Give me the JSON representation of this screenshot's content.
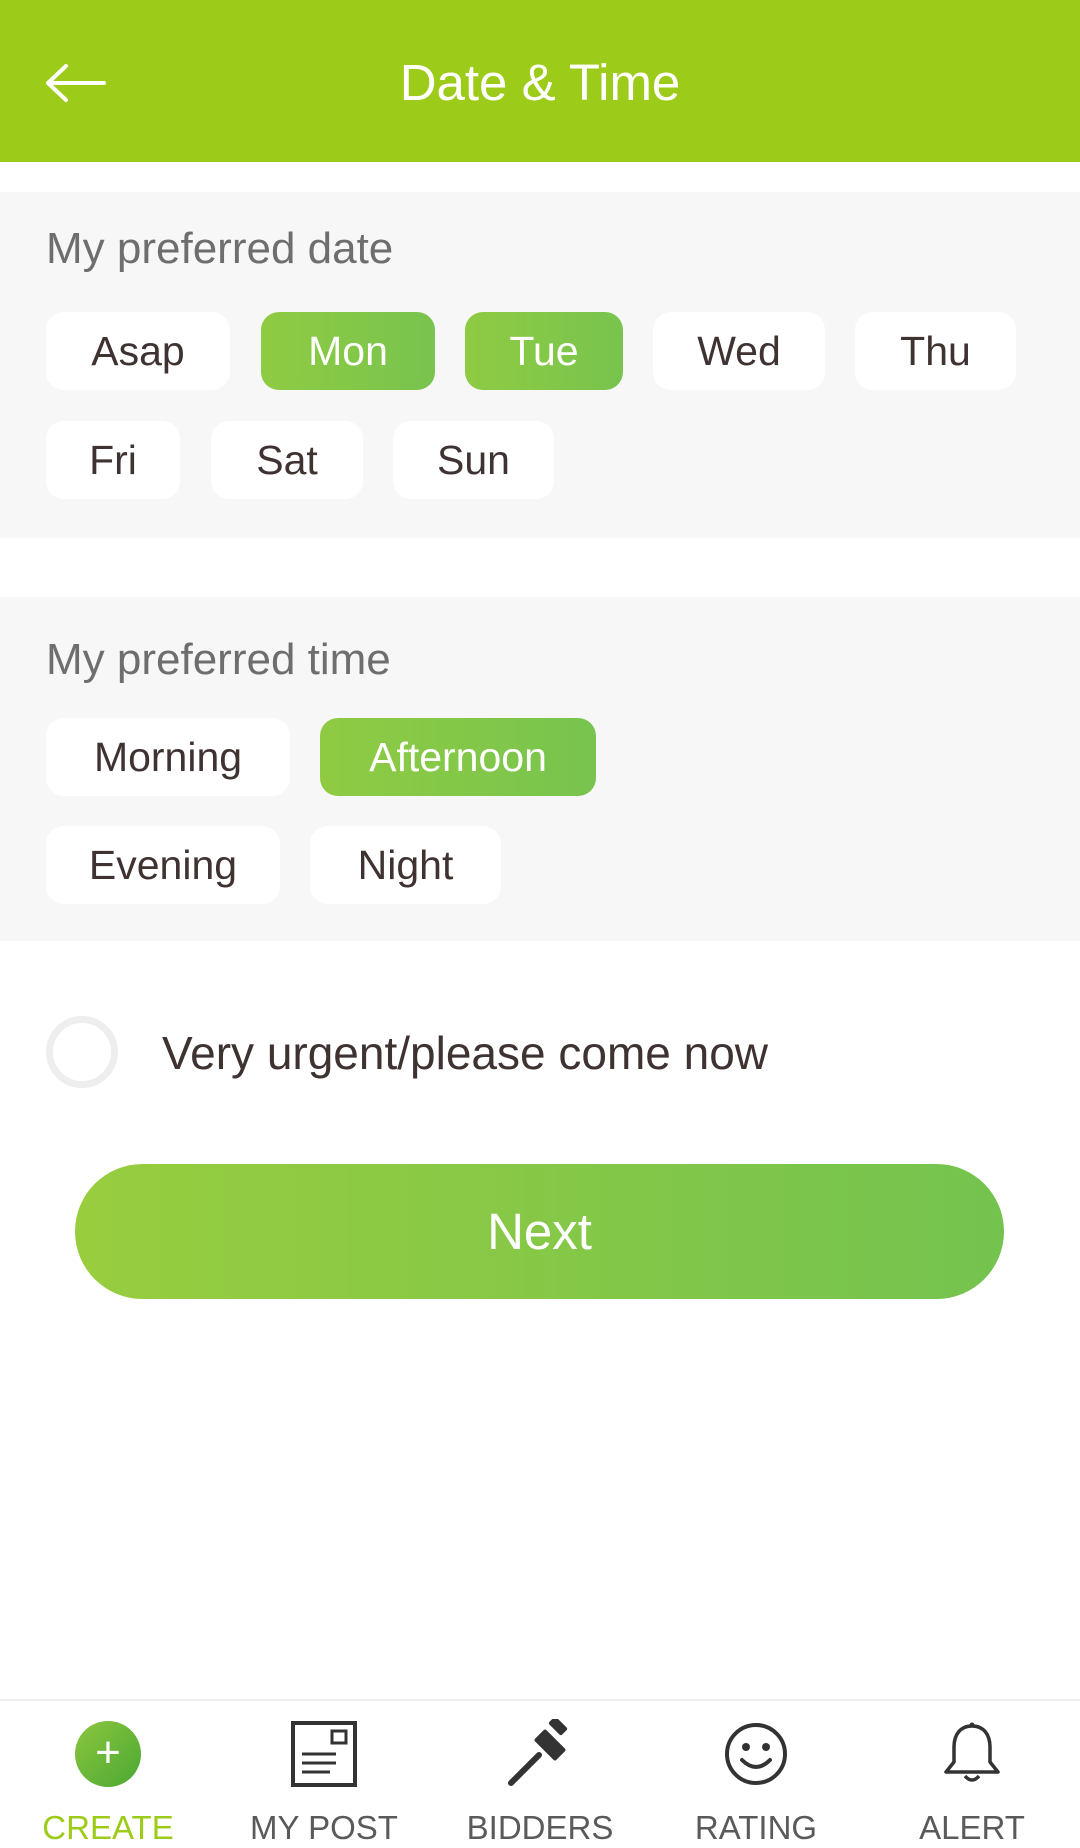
{
  "header": {
    "title": "Date & Time",
    "background": "#9dcb19"
  },
  "date_section": {
    "title": "My preferred date",
    "options": [
      {
        "label": "Asap",
        "selected": false
      },
      {
        "label": "Mon",
        "selected": true
      },
      {
        "label": "Tue",
        "selected": true
      },
      {
        "label": "Wed",
        "selected": false
      },
      {
        "label": "Thu",
        "selected": false
      },
      {
        "label": "Fri",
        "selected": false
      },
      {
        "label": "Sat",
        "selected": false
      },
      {
        "label": "Sun",
        "selected": false
      }
    ]
  },
  "time_section": {
    "title": "My preferred time",
    "options": [
      {
        "label": "Morning",
        "selected": false
      },
      {
        "label": "Afternoon",
        "selected": true
      },
      {
        "label": "Evening",
        "selected": false
      },
      {
        "label": "Night",
        "selected": false
      }
    ]
  },
  "urgent": {
    "label": "Very urgent/please come now",
    "checked": false
  },
  "next_button": {
    "label": "Next"
  },
  "bottom_nav": {
    "items": [
      {
        "label": "CREATE",
        "icon": "plus-circle-icon",
        "active": true
      },
      {
        "label": "MY POST",
        "icon": "post-icon",
        "active": false
      },
      {
        "label": "BIDDERS",
        "icon": "gavel-icon",
        "active": false
      },
      {
        "label": "RATING",
        "icon": "smiley-icon",
        "active": false
      },
      {
        "label": "ALERT",
        "icon": "bell-icon",
        "active": false
      }
    ]
  },
  "colors": {
    "accent": "#9dcb19",
    "selected_chip": "#80c748",
    "text": "#3e3330",
    "section_bg": "#f7f7f7"
  }
}
